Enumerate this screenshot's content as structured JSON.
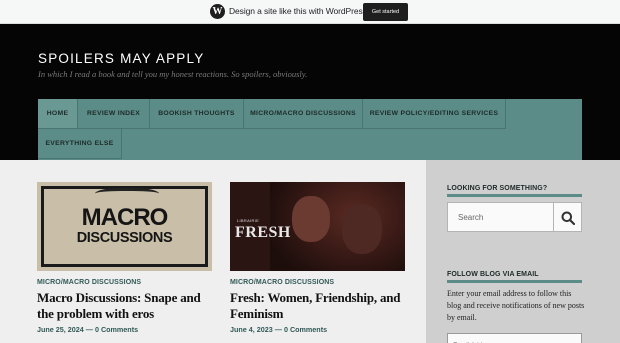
{
  "wp_bar": {
    "text": "Design a site like this with WordPress.com",
    "button": "Get started"
  },
  "header": {
    "title": "SPOILERS MAY APPLY",
    "tagline": "In which I read a book and tell you my honest reactions. So spoilers, obviously."
  },
  "nav": {
    "items": [
      {
        "label": "HOME"
      },
      {
        "label": "REVIEW INDEX"
      },
      {
        "label": "BOOKISH THOUGHTS"
      },
      {
        "label": "MICRO/MACRO DISCUSSIONS"
      },
      {
        "label": "REVIEW POLICY/EDITING SERVICES"
      },
      {
        "label": "EVERYTHING ELSE"
      }
    ]
  },
  "posts": [
    {
      "image_text_line1": "MACRO",
      "image_text_line2": "DISCUSSIONS",
      "category": "MICRO/MACRO DISCUSSIONS",
      "title": "Macro Discussions: Snape and the problem with eros",
      "date": "June 25, 2024",
      "separator": "—",
      "comments": "0 Comments"
    },
    {
      "image_text_small": "LIBRAIRIE",
      "image_text_logo": "FRESH",
      "category": "MICRO/MACRO DISCUSSIONS",
      "title": "Fresh: Women, Friendship, and Feminism",
      "date": "June 4, 2023",
      "separator": "—",
      "comments": "0 Comments"
    }
  ],
  "sidebar": {
    "search_title": "LOOKING FOR SOMETHING?",
    "search_placeholder": "Search",
    "follow_title": "FOLLOW BLOG VIA EMAIL",
    "follow_desc": "Enter your email address to follow this blog and receive notifications of new posts by email.",
    "email_placeholder": "Email Address"
  },
  "colors": {
    "accent": "#5b8c87",
    "header_bg": "#050505",
    "link": "#315a57"
  }
}
